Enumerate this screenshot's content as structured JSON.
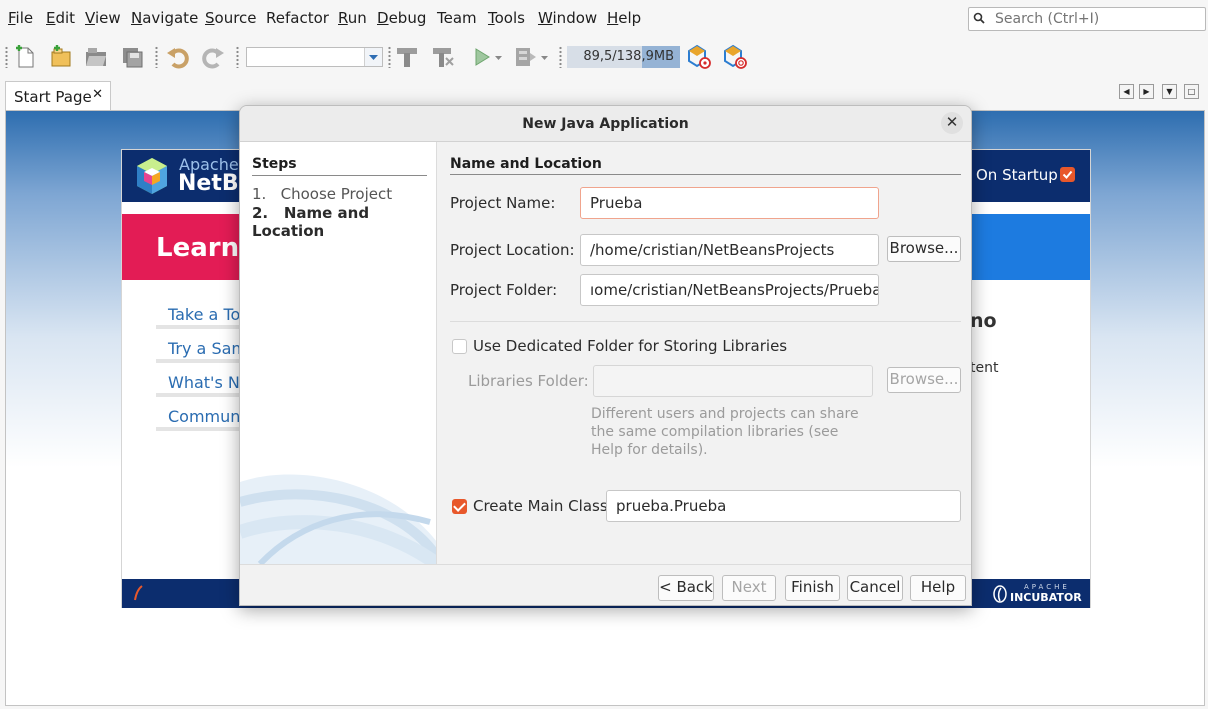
{
  "menubar": {
    "items": [
      {
        "label": "File",
        "u": "F",
        "rest": "ile"
      },
      {
        "label": "Edit",
        "u": "E",
        "rest": "dit"
      },
      {
        "label": "View",
        "u": "V",
        "rest": "iew"
      },
      {
        "label": "Navigate",
        "u": "N",
        "rest": "avigate"
      },
      {
        "label": "Source",
        "u": "S",
        "rest": "ource"
      },
      {
        "label": "Refactor",
        "u": "",
        "rest": "Refactor"
      },
      {
        "label": "Run",
        "u": "R",
        "rest": "un"
      },
      {
        "label": "Debug",
        "u": "D",
        "rest": "ebug"
      },
      {
        "label": "Team",
        "u": "",
        "rest": "Team"
      },
      {
        "label": "Tools",
        "u": "T",
        "rest": "ools"
      },
      {
        "label": "Window",
        "u": "W",
        "rest": "indow"
      },
      {
        "label": "Help",
        "u": "H",
        "rest": "elp"
      }
    ],
    "search_placeholder": "Search (Ctrl+I)"
  },
  "toolbar": {
    "memory_label": "89,5/138,9MB",
    "icons": [
      "new-file-icon",
      "new-project-icon",
      "open-project-icon",
      "save-all-icon",
      "undo-icon",
      "redo-icon",
      "build-icon",
      "clean-build-icon",
      "run-icon",
      "debug-icon",
      "profile-icon",
      "gc-icon"
    ]
  },
  "tabs": {
    "active": "Start Page",
    "close_glyph": "✕",
    "nav": [
      "◀",
      "▶",
      "▼",
      "□"
    ]
  },
  "start_page": {
    "apache": "Apache",
    "netbeans": "NetB",
    "show_on_startup": "On Startup",
    "learn": "Learn",
    "links": [
      "Take a To",
      "Try a Sam",
      "What's N",
      "Commun"
    ],
    "right_heading": "no",
    "right_text": "tent",
    "incubator_top": "APACHE",
    "incubator": "INCUBATOR"
  },
  "dialog": {
    "title": "New Java Application",
    "close_glyph": "✕",
    "steps_heading": "Steps",
    "steps": [
      {
        "num": "1.",
        "label": "Choose Project"
      },
      {
        "num": "2.",
        "label": "Name and Location"
      }
    ],
    "section_heading": "Name and Location",
    "project_name_label": "Project Name:",
    "project_name": "Prueba",
    "project_location_label": "Project Location:",
    "project_location": "/home/cristian/NetBeansProjects",
    "project_folder_label": "Project Folder:",
    "project_folder": "ıome/cristian/NetBeansProjects/Prueba",
    "browse_label": "Browse...",
    "dedicated_folder_label": "Use Dedicated Folder for Storing Libraries",
    "dedicated_folder_checked": false,
    "libraries_folder_label": "Libraries Folder:",
    "libraries_folder": "",
    "libraries_browse_label": "Browse...",
    "hint": "Different users and projects can share the same compilation libraries (see Help for details).",
    "create_main_class_label": "Create Main Class",
    "create_main_class_checked": true,
    "main_class": "prueba.Prueba",
    "buttons": {
      "back": "< Back",
      "next": "Next >",
      "finish": "Finish",
      "cancel": "Cancel",
      "help": "Help"
    }
  },
  "colors": {
    "accent_checkbox": "#e8582b",
    "header_navy": "#0c2d6e",
    "learn_red": "#e31c55",
    "learn_blue": "#1d7be0"
  }
}
